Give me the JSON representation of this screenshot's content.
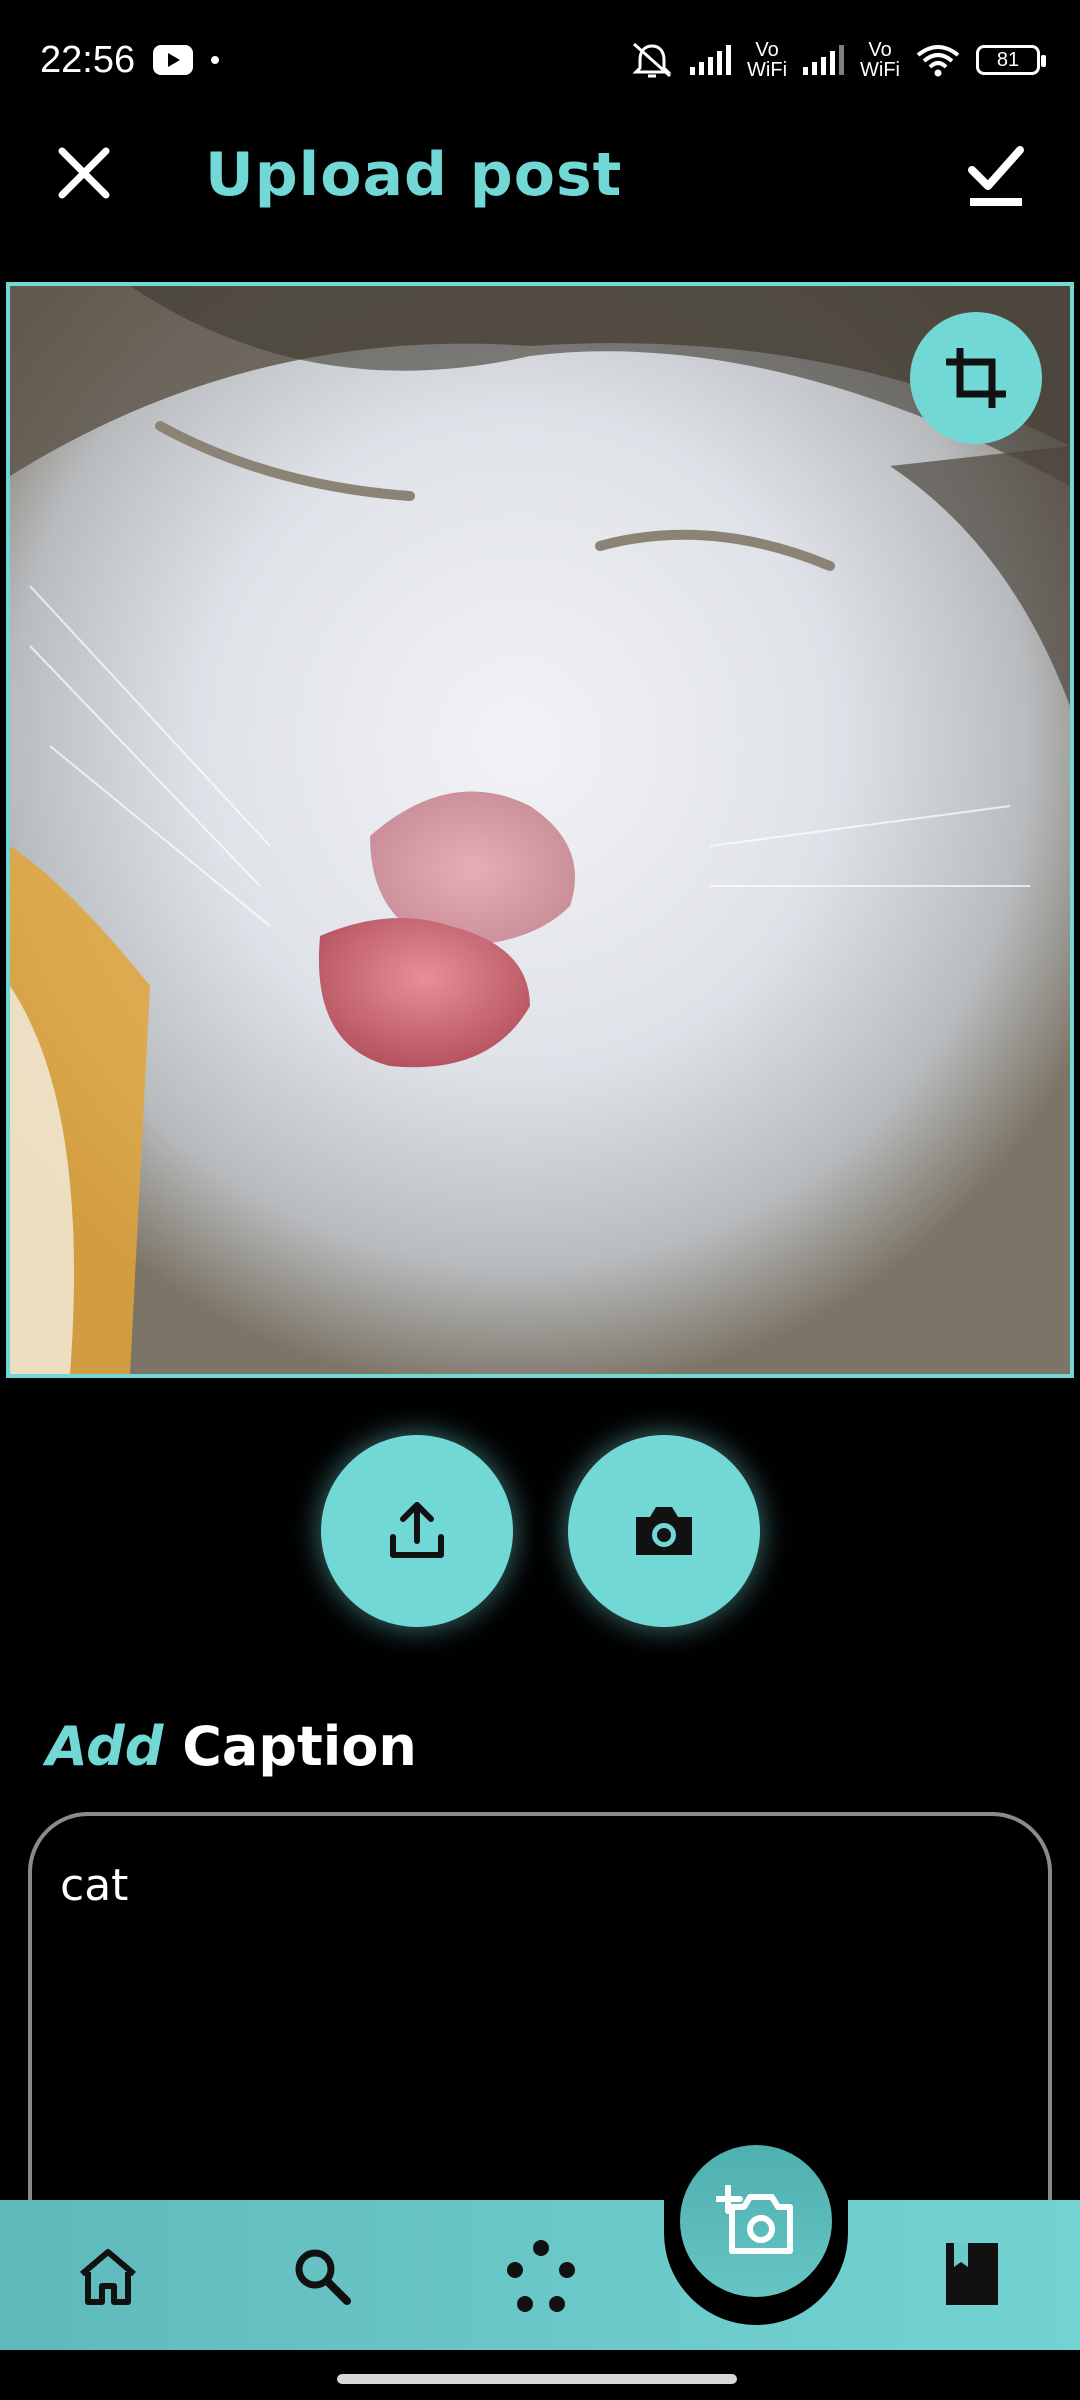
{
  "status_bar": {
    "time": "22:56",
    "battery": "81",
    "network_1": "Vo\nWiFi",
    "network_2": "Vo\nWiFi"
  },
  "header": {
    "title": "Upload post",
    "close_icon": "close-icon",
    "confirm_icon": "check-icon"
  },
  "photo": {
    "crop_icon": "crop-icon"
  },
  "actions": {
    "upload_icon": "upload-icon",
    "camera_icon": "camera-icon"
  },
  "caption": {
    "heading_add": "Add",
    "heading_caption": "Caption",
    "value": "cat"
  },
  "bottom_nav": {
    "items": [
      "home-icon",
      "search-icon",
      "discover-icon",
      "add-photo-icon",
      "bookmark-icon"
    ]
  },
  "colors": {
    "accent": "#72d8d6",
    "background": "#000000"
  }
}
